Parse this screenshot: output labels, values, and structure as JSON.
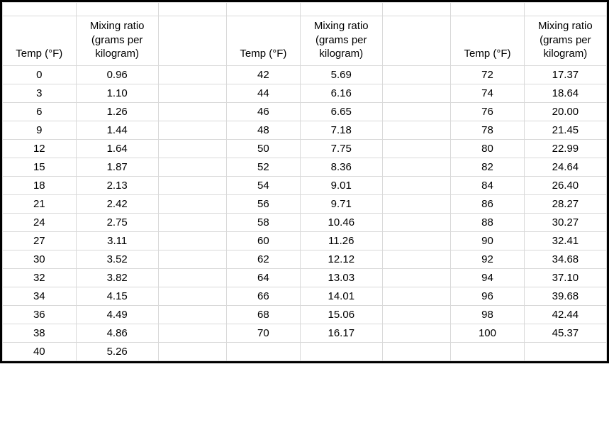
{
  "headers": {
    "temp": "Temp (°F)",
    "ratio": "Mixing ratio (grams per kilogram)"
  },
  "columns": [
    {
      "rows": [
        {
          "t": "0",
          "r": "0.96"
        },
        {
          "t": "3",
          "r": "1.10"
        },
        {
          "t": "6",
          "r": "1.26"
        },
        {
          "t": "9",
          "r": "1.44"
        },
        {
          "t": "12",
          "r": "1.64"
        },
        {
          "t": "15",
          "r": "1.87"
        },
        {
          "t": "18",
          "r": "2.13"
        },
        {
          "t": "21",
          "r": "2.42"
        },
        {
          "t": "24",
          "r": "2.75"
        },
        {
          "t": "27",
          "r": "3.11"
        },
        {
          "t": "30",
          "r": "3.52"
        },
        {
          "t": "32",
          "r": "3.82"
        },
        {
          "t": "34",
          "r": "4.15"
        },
        {
          "t": "36",
          "r": "4.49"
        },
        {
          "t": "38",
          "r": "4.86"
        },
        {
          "t": "40",
          "r": "5.26"
        }
      ]
    },
    {
      "rows": [
        {
          "t": "42",
          "r": "5.69"
        },
        {
          "t": "44",
          "r": "6.16"
        },
        {
          "t": "46",
          "r": "6.65"
        },
        {
          "t": "48",
          "r": "7.18"
        },
        {
          "t": "50",
          "r": "7.75"
        },
        {
          "t": "52",
          "r": "8.36"
        },
        {
          "t": "54",
          "r": "9.01"
        },
        {
          "t": "56",
          "r": "9.71"
        },
        {
          "t": "58",
          "r": "10.46"
        },
        {
          "t": "60",
          "r": "11.26"
        },
        {
          "t": "62",
          "r": "12.12"
        },
        {
          "t": "64",
          "r": "13.03"
        },
        {
          "t": "66",
          "r": "14.01"
        },
        {
          "t": "68",
          "r": "15.06"
        },
        {
          "t": "70",
          "r": "16.17"
        },
        {
          "t": "",
          "r": ""
        }
      ]
    },
    {
      "rows": [
        {
          "t": "72",
          "r": "17.37"
        },
        {
          "t": "74",
          "r": "18.64"
        },
        {
          "t": "76",
          "r": "20.00"
        },
        {
          "t": "78",
          "r": "21.45"
        },
        {
          "t": "80",
          "r": "22.99"
        },
        {
          "t": "82",
          "r": "24.64"
        },
        {
          "t": "84",
          "r": "26.40"
        },
        {
          "t": "86",
          "r": "28.27"
        },
        {
          "t": "88",
          "r": "30.27"
        },
        {
          "t": "90",
          "r": "32.41"
        },
        {
          "t": "92",
          "r": "34.68"
        },
        {
          "t": "94",
          "r": "37.10"
        },
        {
          "t": "96",
          "r": "39.68"
        },
        {
          "t": "98",
          "r": "42.44"
        },
        {
          "t": "100",
          "r": "45.37"
        },
        {
          "t": "",
          "r": ""
        }
      ]
    }
  ]
}
